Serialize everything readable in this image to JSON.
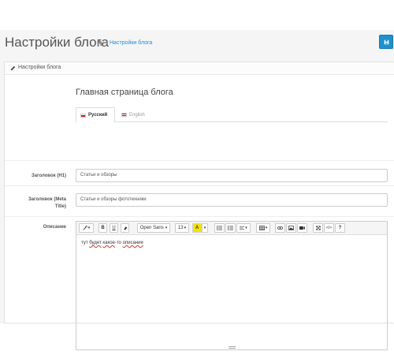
{
  "header": {
    "title": "Настройки блога",
    "breadcrumb_link": "Настройки блога",
    "breadcrumb_sep": "›"
  },
  "panel": {
    "heading": "Настройки блога"
  },
  "section": {
    "title": "Главная страница блога"
  },
  "tabs": [
    {
      "label": "Русский",
      "active": true
    },
    {
      "label": "English",
      "active": false
    }
  ],
  "fields": {
    "h1_label": "Заголовок (H1)",
    "h1_value": "Статьи и обзоры",
    "meta_label_line1": "Заголовок (Meta",
    "meta_label_line2": "Title)",
    "meta_value": "Статьи и обзоры фототехники",
    "desc_label": "Описание"
  },
  "editor": {
    "font": "Open Sans",
    "size": "13",
    "text_1": "тут ",
    "text_2": "будет",
    "text_3": " ",
    "text_4": "какое",
    "text_5": "-то ",
    "text_6": "описание"
  },
  "colors": {
    "accent": "#1e91cf",
    "background": "#f5f5f5",
    "highlight": "#f5e400"
  }
}
